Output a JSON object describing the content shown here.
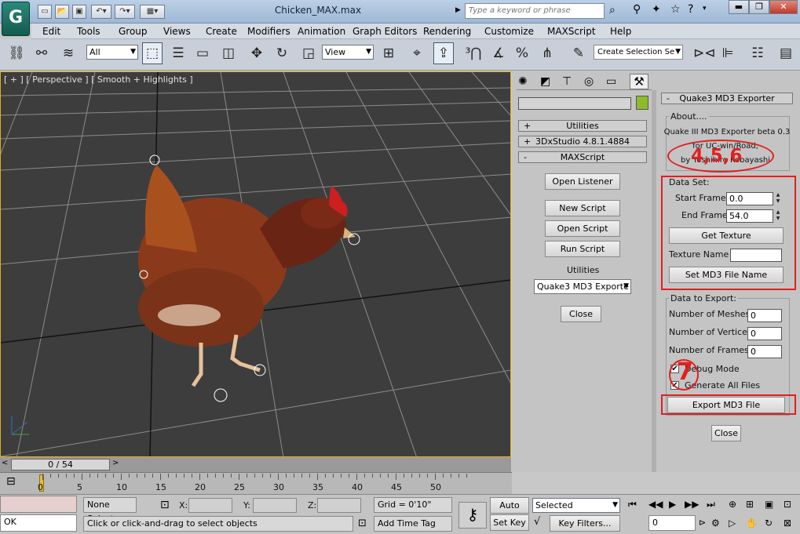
{
  "app": {
    "window_title": "Chicken_MAX.max",
    "logo": "3ds-max-logo"
  },
  "search": {
    "placeholder": "Type a keyword or phrase"
  },
  "menubar": {
    "items": [
      "Edit",
      "Tools",
      "Group",
      "Views",
      "Create",
      "Modifiers",
      "Animation",
      "Graph Editors",
      "Rendering",
      "Customize",
      "MAXScript",
      "Help"
    ]
  },
  "toolbar": {
    "filter_value": "All",
    "refcoord_value": "View",
    "selection_set_placeholder": "Create Selection Se"
  },
  "viewport": {
    "label": "[ + ] [ Perspective ] [ Smooth + Highlights ]",
    "title_numbers": "4,5,6"
  },
  "command_panel": {
    "rollouts": [
      {
        "sign": "+",
        "label": "Utilities"
      },
      {
        "sign": "+",
        "label": "3DxStudio 4.8.1.4884"
      },
      {
        "sign": "-",
        "label": "MAXScript"
      }
    ],
    "maxscript": {
      "open_listener": "Open Listener",
      "new_script": "New Script",
      "open_script": "Open Script",
      "run_script": "Run Script",
      "utilities_label": "Utilities",
      "utility_value": "Quake3 MD3 Exporte",
      "close": "Close"
    }
  },
  "exporter": {
    "title": "Quake3 MD3 Exporter",
    "about_label": "About....",
    "about_lines": [
      "Quake III MD3 Exporter beta 0.3",
      "for UC-win/Road,",
      "by Yoshihiro Kobayashi"
    ],
    "annotation_1": "4,5,6",
    "dataset_label": "Data Set:",
    "start_frame_label": "Start Frame",
    "start_frame_value": "0.0",
    "end_frame_label": "End Frame",
    "end_frame_value": "54.0",
    "get_texture": "Get Texture",
    "texture_name_label": "Texture Name",
    "texture_name_value": "",
    "set_file_name": "Set MD3 File Name",
    "data_to_export_label": "Data to Export:",
    "meshes_label": "Number of Meshes",
    "meshes_value": "0",
    "vertices_label": "Number of Vertices",
    "vertices_value": "0",
    "frames_label": "Number of Frames",
    "frames_value": "0",
    "debug_mode_label": "Debug Mode",
    "debug_mode_checked": true,
    "generate_all_label": "Generate All Files",
    "generate_all_checked": true,
    "annotation_2": "7",
    "export_button": "Export MD3 File",
    "close_button": "Close"
  },
  "timeline": {
    "slider_label": "0 / 54",
    "ticks": [
      "0",
      "5",
      "10",
      "15",
      "20",
      "25",
      "30",
      "35",
      "40",
      "45",
      "50"
    ]
  },
  "status": {
    "listener_value": "OK",
    "selection_state": "None Selecte",
    "x_label": "X:",
    "y_label": "Y:",
    "z_label": "Z:",
    "grid": "Grid = 0'10\"",
    "prompt": "Click or click-and-drag to select objects",
    "add_time_tag": "Add Time Tag",
    "auto_key": "Auto Key",
    "set_key": "Set Key",
    "key_mode_value": "Selected",
    "key_filters": "Key Filters...",
    "frame_value": "0"
  },
  "colors": {
    "accent_red": "#e02020",
    "viewport_bg": "#3d3d3d",
    "viewport_border": "#e3b018"
  }
}
